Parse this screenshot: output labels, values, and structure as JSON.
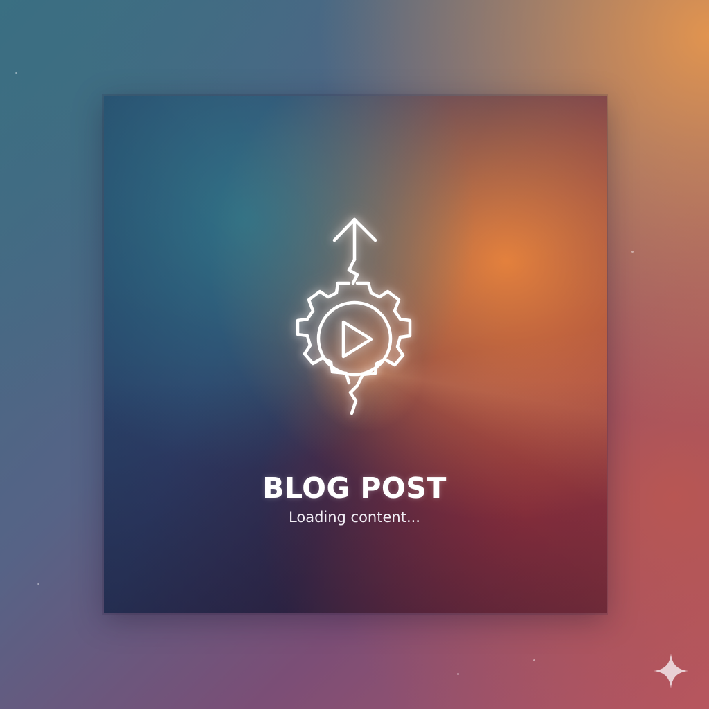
{
  "card": {
    "title": "BLOG POST",
    "status_text": "Loading content..."
  },
  "icons": {
    "emblem": "gear-play-upload-icon",
    "corner": "sparkle-icon"
  },
  "colors": {
    "top_left": "#3a6e82",
    "top_right": "#e7974d",
    "bottom_right": "#b45566",
    "card_left": "#23486a",
    "card_right": "#eb8339",
    "text": "#ffffff"
  }
}
